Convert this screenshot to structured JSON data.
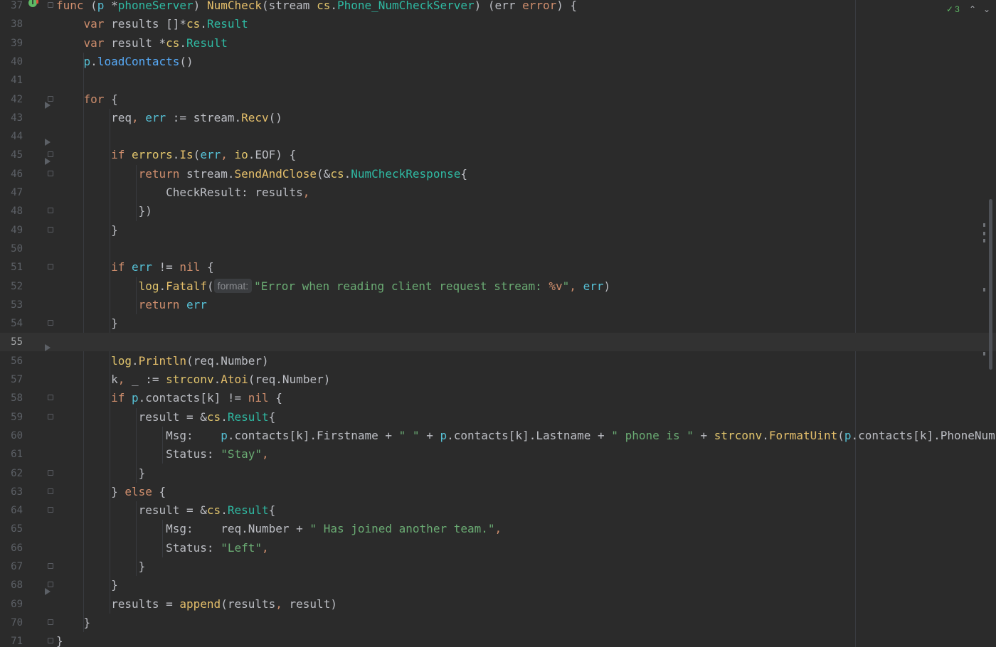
{
  "editor": {
    "inspection": {
      "icon": "check-double-icon",
      "count": "3",
      "color": "#5fb865"
    },
    "nav": {
      "up": "^",
      "down": "v"
    },
    "current_line": "55",
    "hint_label": "format:",
    "lines": [
      {
        "n": "37",
        "tokens": [
          [
            "t-kw",
            "func"
          ],
          [
            "t-punc",
            " ("
          ],
          [
            "t-recv",
            "p"
          ],
          [
            "t-punc",
            " *"
          ],
          [
            "t-type",
            "phoneServer"
          ],
          [
            "t-punc",
            ") "
          ],
          [
            "t-fnd",
            "NumCheck"
          ],
          [
            "t-punc",
            "("
          ],
          [
            "t-param",
            "stream"
          ],
          [
            "t-punc",
            " "
          ],
          [
            "t-pkg",
            "cs"
          ],
          [
            "t-punc",
            "."
          ],
          [
            "t-type",
            "Phone_NumCheckServer"
          ],
          [
            "t-punc",
            ") ("
          ],
          [
            "t-param",
            "err"
          ],
          [
            "t-punc",
            " "
          ],
          [
            "t-kw",
            "error"
          ],
          [
            "t-punc",
            ") {"
          ]
        ]
      },
      {
        "n": "38",
        "tokens": [
          [
            "t-punc",
            "    "
          ],
          [
            "t-kw",
            "var"
          ],
          [
            "t-punc",
            " results []*"
          ],
          [
            "t-pkg",
            "cs"
          ],
          [
            "t-punc",
            "."
          ],
          [
            "t-type",
            "Result"
          ]
        ]
      },
      {
        "n": "39",
        "tokens": [
          [
            "t-punc",
            "    "
          ],
          [
            "t-kw",
            "var"
          ],
          [
            "t-punc",
            " result *"
          ],
          [
            "t-pkg",
            "cs"
          ],
          [
            "t-punc",
            "."
          ],
          [
            "t-type",
            "Result"
          ]
        ]
      },
      {
        "n": "40",
        "tokens": [
          [
            "t-punc",
            "    "
          ],
          [
            "t-recv",
            "p"
          ],
          [
            "t-punc",
            "."
          ],
          [
            "t-call",
            "loadContacts"
          ],
          [
            "t-punc",
            "()"
          ]
        ]
      },
      {
        "n": "41",
        "tokens": []
      },
      {
        "n": "42",
        "tokens": [
          [
            "t-punc",
            "    "
          ],
          [
            "t-kw",
            "for"
          ],
          [
            "t-punc",
            " {"
          ]
        ]
      },
      {
        "n": "43",
        "tokens": [
          [
            "t-punc",
            "        req"
          ],
          [
            "t-comma",
            ","
          ],
          [
            "t-punc",
            " "
          ],
          [
            "t-recv",
            "err"
          ],
          [
            "t-punc",
            " := stream."
          ],
          [
            "t-fnd",
            "Recv"
          ],
          [
            "t-punc",
            "()"
          ]
        ]
      },
      {
        "n": "44",
        "tokens": []
      },
      {
        "n": "45",
        "tokens": [
          [
            "t-punc",
            "        "
          ],
          [
            "t-kw",
            "if"
          ],
          [
            "t-punc",
            " "
          ],
          [
            "t-pkg",
            "errors"
          ],
          [
            "t-punc",
            "."
          ],
          [
            "t-fnd",
            "Is"
          ],
          [
            "t-punc",
            "("
          ],
          [
            "t-recv",
            "err"
          ],
          [
            "t-comma",
            ","
          ],
          [
            "t-punc",
            " "
          ],
          [
            "t-pkg",
            "io"
          ],
          [
            "t-punc",
            ".EOF) {"
          ]
        ]
      },
      {
        "n": "46",
        "tokens": [
          [
            "t-punc",
            "            "
          ],
          [
            "t-kw",
            "return"
          ],
          [
            "t-punc",
            " stream."
          ],
          [
            "t-fnd",
            "SendAndClose"
          ],
          [
            "t-punc",
            "(&"
          ],
          [
            "t-pkg",
            "cs"
          ],
          [
            "t-punc",
            "."
          ],
          [
            "t-type",
            "NumCheckResponse"
          ],
          [
            "t-punc",
            "{"
          ]
        ]
      },
      {
        "n": "47",
        "tokens": [
          [
            "t-punc",
            "                CheckResult: results"
          ],
          [
            "t-comma",
            ","
          ]
        ]
      },
      {
        "n": "48",
        "tokens": [
          [
            "t-punc",
            "            })"
          ]
        ]
      },
      {
        "n": "49",
        "tokens": [
          [
            "t-punc",
            "        }"
          ]
        ]
      },
      {
        "n": "50",
        "tokens": []
      },
      {
        "n": "51",
        "tokens": [
          [
            "t-punc",
            "        "
          ],
          [
            "t-kw",
            "if"
          ],
          [
            "t-punc",
            " "
          ],
          [
            "t-recv",
            "err"
          ],
          [
            "t-punc",
            " != "
          ],
          [
            "t-nil",
            "nil"
          ],
          [
            "t-punc",
            " {"
          ]
        ]
      },
      {
        "n": "52",
        "hint": true,
        "tokens": [
          [
            "t-punc",
            "            "
          ],
          [
            "t-pkg",
            "log"
          ],
          [
            "t-punc",
            "."
          ],
          [
            "t-fnd",
            "Fatalf"
          ],
          [
            "t-punc",
            "("
          ],
          [
            "HINT",
            ""
          ],
          [
            "t-str",
            "\"Error when reading client request stream: "
          ],
          [
            "t-fmt",
            "%v"
          ],
          [
            "t-str",
            "\""
          ],
          [
            "t-comma",
            ","
          ],
          [
            "t-punc",
            " "
          ],
          [
            "t-recv",
            "err"
          ],
          [
            "t-punc",
            ")"
          ]
        ]
      },
      {
        "n": "53",
        "tokens": [
          [
            "t-punc",
            "            "
          ],
          [
            "t-kw",
            "return"
          ],
          [
            "t-punc",
            " "
          ],
          [
            "t-recv",
            "err"
          ]
        ]
      },
      {
        "n": "54",
        "tokens": [
          [
            "t-punc",
            "        }"
          ]
        ]
      },
      {
        "n": "55",
        "tokens": []
      },
      {
        "n": "56",
        "tokens": [
          [
            "t-punc",
            "        "
          ],
          [
            "t-pkg",
            "log"
          ],
          [
            "t-punc",
            "."
          ],
          [
            "t-fnd",
            "Println"
          ],
          [
            "t-punc",
            "(req.Number)"
          ]
        ]
      },
      {
        "n": "57",
        "tokens": [
          [
            "t-punc",
            "        k"
          ],
          [
            "t-comma",
            ","
          ],
          [
            "t-punc",
            " _ := "
          ],
          [
            "t-pkg",
            "strconv"
          ],
          [
            "t-punc",
            "."
          ],
          [
            "t-fnd",
            "Atoi"
          ],
          [
            "t-punc",
            "(req.Number)"
          ]
        ]
      },
      {
        "n": "58",
        "tokens": [
          [
            "t-punc",
            "        "
          ],
          [
            "t-kw",
            "if"
          ],
          [
            "t-punc",
            " "
          ],
          [
            "t-recv",
            "p"
          ],
          [
            "t-punc",
            ".contacts[k] != "
          ],
          [
            "t-nil",
            "nil"
          ],
          [
            "t-punc",
            " {"
          ]
        ]
      },
      {
        "n": "59",
        "tokens": [
          [
            "t-punc",
            "            result = &"
          ],
          [
            "t-pkg",
            "cs"
          ],
          [
            "t-punc",
            "."
          ],
          [
            "t-type",
            "Result"
          ],
          [
            "t-punc",
            "{"
          ]
        ]
      },
      {
        "n": "60",
        "tokens": [
          [
            "t-punc",
            "                Msg:    "
          ],
          [
            "t-recv",
            "p"
          ],
          [
            "t-punc",
            ".contacts[k].Firstname + "
          ],
          [
            "t-str",
            "\" \""
          ],
          [
            "t-punc",
            " + "
          ],
          [
            "t-recv",
            "p"
          ],
          [
            "t-punc",
            ".contacts[k].Lastname + "
          ],
          [
            "t-str",
            "\" phone is \""
          ],
          [
            "t-punc",
            " + "
          ],
          [
            "t-pkg",
            "strconv"
          ],
          [
            "t-punc",
            "."
          ],
          [
            "t-fnd",
            "FormatUint"
          ],
          [
            "t-punc",
            "("
          ],
          [
            "t-recv",
            "p"
          ],
          [
            "t-punc",
            ".contacts[k].PhoneNumber"
          ],
          [
            "t-comma",
            ","
          ]
        ]
      },
      {
        "n": "61",
        "tokens": [
          [
            "t-punc",
            "                Status: "
          ],
          [
            "t-str",
            "\"Stay\""
          ],
          [
            "t-comma",
            ","
          ]
        ]
      },
      {
        "n": "62",
        "tokens": [
          [
            "t-punc",
            "            }"
          ]
        ]
      },
      {
        "n": "63",
        "tokens": [
          [
            "t-punc",
            "        } "
          ],
          [
            "t-kw",
            "else"
          ],
          [
            "t-punc",
            " {"
          ]
        ]
      },
      {
        "n": "64",
        "tokens": [
          [
            "t-punc",
            "            result = &"
          ],
          [
            "t-pkg",
            "cs"
          ],
          [
            "t-punc",
            "."
          ],
          [
            "t-type",
            "Result"
          ],
          [
            "t-punc",
            "{"
          ]
        ]
      },
      {
        "n": "65",
        "tokens": [
          [
            "t-punc",
            "                Msg:    req.Number + "
          ],
          [
            "t-str",
            "\" Has joined another team.\""
          ],
          [
            "t-comma",
            ","
          ]
        ]
      },
      {
        "n": "66",
        "tokens": [
          [
            "t-punc",
            "                Status: "
          ],
          [
            "t-str",
            "\"Left\""
          ],
          [
            "t-comma",
            ","
          ]
        ]
      },
      {
        "n": "67",
        "tokens": [
          [
            "t-punc",
            "            }"
          ]
        ]
      },
      {
        "n": "68",
        "tokens": [
          [
            "t-punc",
            "        }"
          ]
        ]
      },
      {
        "n": "69",
        "tokens": [
          [
            "t-punc",
            "        results = "
          ],
          [
            "t-fnd",
            "append"
          ],
          [
            "t-punc",
            "(results"
          ],
          [
            "t-comma",
            ","
          ],
          [
            "t-punc",
            " result)"
          ]
        ]
      },
      {
        "n": "70",
        "tokens": [
          [
            "t-punc",
            "    }"
          ]
        ]
      },
      {
        "n": "71",
        "tokens": [
          [
            "t-punc",
            "}"
          ]
        ]
      }
    ]
  }
}
